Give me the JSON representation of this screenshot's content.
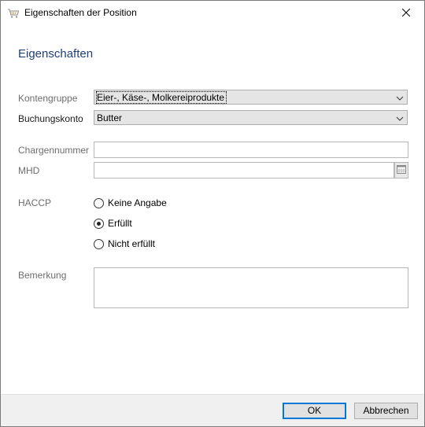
{
  "window": {
    "title": "Eigenschaften der Position"
  },
  "section": {
    "title": "Eigenschaften"
  },
  "fields": {
    "kontengruppe": {
      "label": "Kontengruppe",
      "value": "Eier-, Käse-, Molkereiprodukte"
    },
    "buchungskonto": {
      "label": "Buchungskonto",
      "value": "Butter"
    },
    "chargennummer": {
      "label": "Chargennummer",
      "value": ""
    },
    "mhd": {
      "label": "MHD",
      "value": ""
    },
    "haccp": {
      "label": "HACCP",
      "options": [
        {
          "label": "Keine Angabe",
          "checked": false
        },
        {
          "label": "Erfüllt",
          "checked": true
        },
        {
          "label": "Nicht erfüllt",
          "checked": false
        }
      ]
    },
    "bemerkung": {
      "label": "Bemerkung",
      "value": ""
    }
  },
  "buttons": {
    "ok": "OK",
    "cancel": "Abbrechen"
  },
  "icons": {
    "app": "basket-icon",
    "close": "close-icon",
    "dropdown": "chevron-down-icon",
    "calendar": "calendar-icon"
  },
  "colors": {
    "section_title": "#1f3f7a",
    "default_button_border": "#0078d7"
  }
}
